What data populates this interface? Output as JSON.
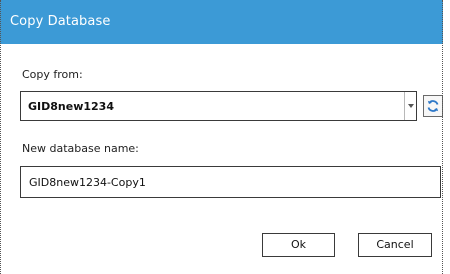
{
  "window": {
    "title": "Copy Database",
    "accent_color": "#3c9ad6"
  },
  "copy_from": {
    "label": "Copy from:",
    "selected_value": "GID8new1234",
    "refresh_icon": "refresh-icon"
  },
  "new_name": {
    "label": "New database name:",
    "value": "GID8new1234-Copy1"
  },
  "buttons": {
    "ok": "Ok",
    "cancel": "Cancel"
  }
}
